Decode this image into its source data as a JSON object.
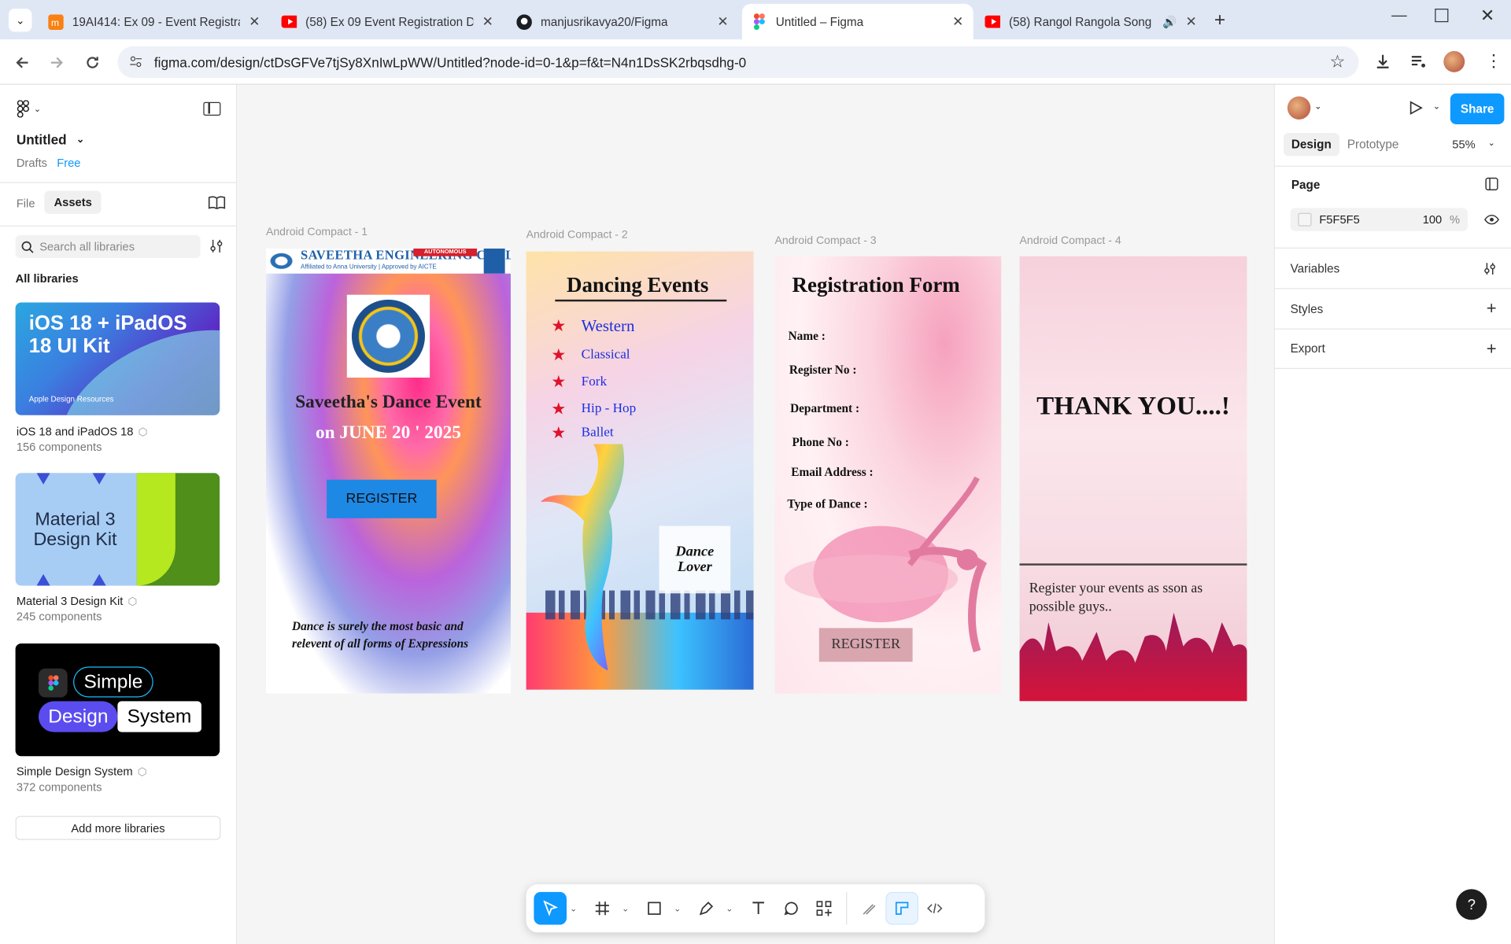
{
  "browser": {
    "tabs": [
      {
        "title": "19AI414: Ex 09 - Event Registrat",
        "icon": "moodle-icon"
      },
      {
        "title": "(58) Ex 09 Event Registration De",
        "icon": "youtube-icon"
      },
      {
        "title": "manjusrikavya20/Figma",
        "icon": "github-icon"
      },
      {
        "title": "Untitled – Figma",
        "icon": "figma-icon"
      },
      {
        "title": "(58) Rangol Rangola Song (",
        "icon": "youtube-icon"
      }
    ],
    "url": "figma.com/design/ctDsGFVe7tjSy8XnIwLpWW/Untitled?node-id=0-1&p=f&t=N4n1DsSK2rbqsdhg-0"
  },
  "left": {
    "file_name": "Untitled",
    "drafts": "Drafts",
    "plan": "Free",
    "tab_file": "File",
    "tab_assets": "Assets",
    "search_placeholder": "Search all libraries",
    "all_libraries": "All libraries",
    "libraries": [
      {
        "name": "iOS 18 and iPadOS 18",
        "count": "156 components",
        "thumb_title": "iOS 18 + iPadOS 18 UI Kit",
        "thumb_sub": "Apple Design Resources"
      },
      {
        "name": "Material 3 Design Kit",
        "count": "245 components",
        "thumb_title": "Material 3 Design Kit"
      },
      {
        "name": "Simple Design System",
        "count": "372 components",
        "thumb_words": [
          "Simple",
          "Design",
          "System"
        ]
      }
    ],
    "add_more": "Add more libraries"
  },
  "canvas": {
    "frames": [
      {
        "label": "Android Compact - 1",
        "college": "SAVEETHA ENGINEERING COLLEGE",
        "autonomous": "AUTONOMOUS",
        "affiliation": "Affiliated to Anna University | Approved by AICTE",
        "title1": "Saveetha's Dance Event",
        "title2": "on JUNE 20 ' 2025",
        "register": "REGISTER",
        "quote": "Dance is surely  the most basic and relevent of all forms of Expressions"
      },
      {
        "label": "Android Compact - 2",
        "heading": "Dancing Events",
        "items": [
          "Western",
          "Classical",
          "Fork",
          "Hip - Hop",
          "Ballet"
        ],
        "sticker": "Dance Lover"
      },
      {
        "label": "Android Compact - 3",
        "heading": "Registration Form",
        "fields": [
          "Name :",
          "Register No :",
          "Department :",
          "Phone No :",
          "Email Address :",
          "Type of Dance :"
        ],
        "register": "REGISTER"
      },
      {
        "label": "Android Compact - 4",
        "thanks": "THANK YOU....!",
        "message": "Register your events as sson as possible guys.."
      }
    ]
  },
  "right": {
    "tab_design": "Design",
    "tab_prototype": "Prototype",
    "zoom": "55%",
    "share": "Share",
    "page_title": "Page",
    "page_color": "F5F5F5",
    "page_opacity": "100",
    "percent": "%",
    "variables": "Variables",
    "styles": "Styles",
    "export": "Export"
  },
  "help": "?"
}
